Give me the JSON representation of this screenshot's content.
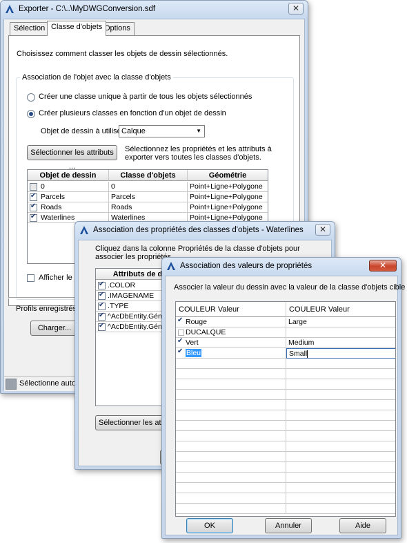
{
  "export": {
    "title": "Exporter - C:\\..\\MyDWGConversion.sdf",
    "tabs": [
      "Sélection",
      "Classe d'objets",
      "Options"
    ],
    "instruction": "Choisissez comment classer les objets de dessin sélectionnés.",
    "group_title": "Association de l'objet avec la classe d'objets",
    "radio_unique": "Créer une classe unique à partir de tous les objets sélectionnés",
    "radio_multi": "Créer plusieurs classes en fonction d'un objet de dessin",
    "object_label": "Objet de dessin à utiliser:",
    "object_value": "Calque",
    "select_attrs_button": "Sélectionner les attributs ...",
    "select_attrs_desc": "Sélectionnez les propriétés et les attributs à exporter vers toutes les classes d'objets.",
    "columns": [
      "Objet de dessin",
      "Classe d'objets",
      "Géométrie"
    ],
    "rows": [
      {
        "checked": false,
        "object": "0",
        "class": "0",
        "geometry": "Point+Ligne+Polygone"
      },
      {
        "checked": true,
        "object": "Parcels",
        "class": "Parcels",
        "geometry": "Point+Ligne+Polygone"
      },
      {
        "checked": true,
        "object": "Roads",
        "class": "Roads",
        "geometry": "Point+Ligne+Polygone"
      },
      {
        "checked": true,
        "object": "Waterlines",
        "class": "Waterlines",
        "geometry": "Point+Ligne+Polygone"
      }
    ],
    "show_label": "Afficher le no",
    "profiles_label": "Profils enregistrés",
    "load_button": "Charger...",
    "status_text": "Sélectionne autor"
  },
  "assoc": {
    "title": "Association des propriétés des classes d'objets - Waterlines",
    "instruction": "Cliquez dans la colonne Propriétés de la classe d'objets pour associer les propriétés",
    "column": "Attributs de d",
    "rows": [
      {
        "checked": true,
        "label": ".COLOR"
      },
      {
        "checked": true,
        "label": ".IMAGENAME"
      },
      {
        "checked": true,
        "label": ".TYPE"
      },
      {
        "checked": true,
        "label": "^AcDbEntity.Géné"
      },
      {
        "checked": true,
        "label": "^AcDbEntity.Géné"
      }
    ],
    "select_button": "Sélectionner les attrib"
  },
  "values": {
    "title": "Association des valeurs de propriétés",
    "instruction": "Associer la valeur du dessin avec la valeur de la classe d'objets cible",
    "columns": [
      "COULEUR Valeur",
      "COULEUR Valeur"
    ],
    "rows": [
      {
        "checked": true,
        "drawing": "Rouge",
        "target": "Large"
      },
      {
        "checked": false,
        "drawing": "DUCALQUE",
        "target": ""
      },
      {
        "checked": true,
        "drawing": "Vert",
        "target": "Medium"
      },
      {
        "checked": true,
        "drawing": "Bleu",
        "target": "Small"
      }
    ],
    "ok": "OK",
    "cancel": "Annuler",
    "help": "Aide"
  }
}
